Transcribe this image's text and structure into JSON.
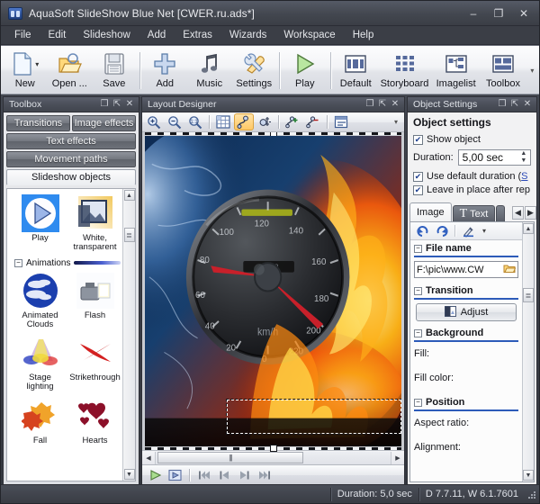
{
  "window": {
    "title": "AquaSoft SlideShow Blue Net [CWER.ru.ads*]",
    "icon": "app-icon",
    "minimize": "–",
    "maximize": "❐",
    "close": "✕"
  },
  "menu": {
    "items": [
      {
        "label": "File",
        "accel": "F"
      },
      {
        "label": "Edit",
        "accel": "E"
      },
      {
        "label": "Slideshow",
        "accel": "l"
      },
      {
        "label": "Add",
        "accel": "A"
      },
      {
        "label": "Extras",
        "accel": "x"
      },
      {
        "label": "Wizards",
        "accel": "W"
      },
      {
        "label": "Workspace",
        "accel": "p"
      },
      {
        "label": "Help",
        "accel": "H"
      }
    ]
  },
  "toolbar": {
    "buttons": [
      {
        "label": "New",
        "icon": "new-page-icon",
        "dropdown": true
      },
      {
        "label": "Open ...",
        "icon": "open-folder-icon",
        "dropdown": false
      },
      {
        "label": "Save",
        "icon": "save-disk-icon",
        "dropdown": false
      },
      {
        "label": "Add",
        "icon": "add-plus-icon",
        "dropdown": false
      },
      {
        "label": "Music",
        "icon": "music-note-icon",
        "dropdown": false
      },
      {
        "label": "Settings",
        "icon": "settings-tools-icon",
        "dropdown": false
      },
      {
        "label": "Play",
        "icon": "play-triangle-icon",
        "dropdown": false
      },
      {
        "label": "Default",
        "icon": "default-layout-icon",
        "dropdown": false
      },
      {
        "label": "Storyboard",
        "icon": "storyboard-grid-icon",
        "dropdown": false
      },
      {
        "label": "Imagelist",
        "icon": "imagelist-tree-icon",
        "dropdown": false
      },
      {
        "label": "Toolbox",
        "icon": "toolbox-layout-icon",
        "dropdown": false
      }
    ],
    "overflow": "▾"
  },
  "toolbox": {
    "panel_title": "Toolbox",
    "panel_buttons": {
      "restore": "❐",
      "pin": "⇱",
      "close": "✕"
    },
    "categories": [
      {
        "label": "Transitions",
        "active": false
      },
      {
        "label": "Image effects",
        "active": false
      },
      {
        "label": "Text effects",
        "active": false
      },
      {
        "label": "Movement paths",
        "active": false
      },
      {
        "label": "Slideshow objects",
        "active": true
      }
    ],
    "objects": [
      {
        "label": "Play",
        "icon": "play-object-icon",
        "selected": true
      },
      {
        "label": "White, transparent",
        "icon": "white-transparent-image-icon",
        "selected": false
      }
    ],
    "group": {
      "label": "Animations",
      "collapse": "−"
    },
    "animations": [
      {
        "label": "Animated Clouds",
        "icon": "animated-clouds-icon"
      },
      {
        "label": "Flash",
        "icon": "flash-light-icon"
      },
      {
        "label": "Stage lighting",
        "icon": "stage-lighting-icon"
      },
      {
        "label": "Strikethrough",
        "icon": "strikethrough-x-icon"
      },
      {
        "label": "Fall",
        "icon": "fall-leaves-icon"
      },
      {
        "label": "Hearts",
        "icon": "hearts-icon"
      }
    ],
    "scroll": {
      "up": "▲",
      "down": "▼",
      "thumb": "≣"
    }
  },
  "designer": {
    "panel_title": "Layout Designer",
    "panel_buttons": {
      "restore": "❐",
      "pin": "⇱",
      "close": "✕"
    },
    "tools": [
      {
        "name": "zoom-in-icon",
        "active": false
      },
      {
        "name": "zoom-out-icon",
        "active": false
      },
      {
        "name": "zoom-reset-icon",
        "active": false
      },
      {
        "name": "grid-icon",
        "active": false
      },
      {
        "name": "motion-path-icon",
        "active": true
      },
      {
        "name": "move-object-icon",
        "active": false
      },
      {
        "name": "add-keyframe-icon",
        "active": false
      },
      {
        "name": "remove-keyframe-icon",
        "active": false
      },
      {
        "name": "align-objects-icon",
        "active": false
      }
    ],
    "overflow": "▾",
    "canvas": {
      "image_alt": "speedometer-fire-water-image",
      "has_text_placeholder": true
    },
    "hscroll": {
      "left": "◀",
      "right": "▶",
      "thumb": "|||"
    },
    "transport": [
      {
        "name": "play-preview-icon"
      },
      {
        "name": "play-frame-icon"
      },
      {
        "name": "first-frame-icon"
      },
      {
        "name": "prev-frame-icon"
      },
      {
        "name": "next-frame-icon"
      },
      {
        "name": "last-frame-icon"
      }
    ]
  },
  "objectSettings": {
    "panel_title": "Object Settings",
    "panel_buttons": {
      "restore": "❐",
      "pin": "⇱",
      "close": "✕"
    },
    "heading": "Object settings",
    "show_object": {
      "label": "Show object",
      "checked": true
    },
    "duration": {
      "label": "Duration:",
      "value": "5,00 sec",
      "up": "▲",
      "down": "▼"
    },
    "use_default_duration": {
      "label": "Use default duration (",
      "link": "S",
      "checked": true
    },
    "leave_in_place": {
      "label": "Leave in place after rep",
      "checked": true
    },
    "tabs": [
      {
        "label": "Image",
        "icon": "",
        "active": true
      },
      {
        "label": "Text",
        "icon": "T",
        "active": false
      },
      {
        "label": "",
        "icon": "",
        "active": false
      }
    ],
    "tab_nav": {
      "prev": "◀",
      "next": "▶"
    },
    "mini_toolbar": [
      {
        "name": "rotate-left-icon"
      },
      {
        "name": "rotate-right-icon"
      },
      {
        "name": "color-pick-icon"
      },
      {
        "name": "dropdown-arrow-icon"
      }
    ],
    "sections": [
      {
        "key": "filename",
        "label": "File name",
        "collapse": "−"
      },
      {
        "key": "transition",
        "label": "Transition",
        "collapse": "−"
      },
      {
        "key": "background",
        "label": "Background",
        "collapse": "−"
      },
      {
        "key": "position",
        "label": "Position",
        "collapse": "−"
      }
    ],
    "file_name_value": "F:\\pic\\www.CW",
    "file_browse_icon": "browse-folder-icon",
    "adjust_button": {
      "label": "Adjust",
      "icon": "adjust-image-icon"
    },
    "background_fields": [
      {
        "label": "Fill:"
      },
      {
        "label": "Fill color:"
      }
    ],
    "position_fields": [
      {
        "label": "Aspect ratio:"
      },
      {
        "label": "Alignment:"
      }
    ],
    "scroll": {
      "up": "▲",
      "down": "▼",
      "thumb": "≣"
    }
  },
  "status": {
    "duration": "Duration: 5,0 sec",
    "version": "D 7.7.11, W 6.1.7601",
    "grip": "resize-grip"
  },
  "colors": {
    "accent": "#2d5bb9",
    "chrome_dark": "#3b3e46",
    "highlight": "#ffc865"
  }
}
